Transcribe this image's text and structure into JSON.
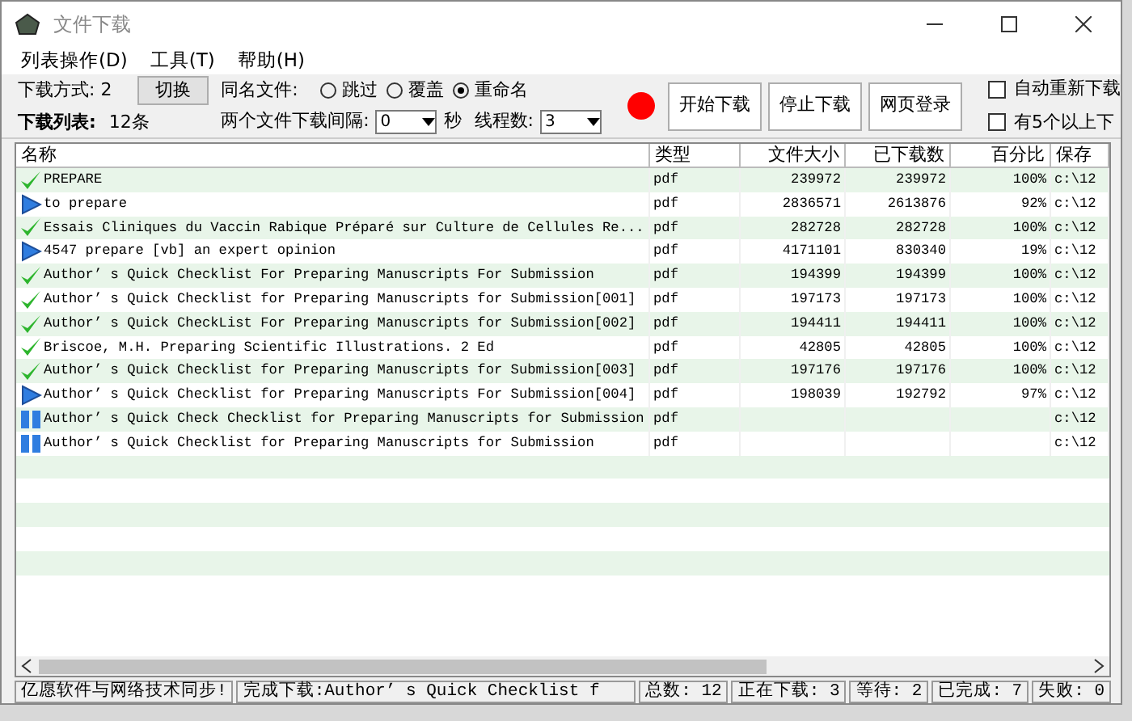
{
  "window": {
    "title": "文件下载"
  },
  "menu": [
    "列表操作(D)",
    "工具(T)",
    "帮助(H)"
  ],
  "toolbar": {
    "mode_label": "下载方式: 2",
    "switch_button": "切换",
    "list_label": "下载列表:",
    "list_count": "12条",
    "same_name_label": "同名文件:",
    "same_name_options": [
      {
        "label": "跳过",
        "selected": false
      },
      {
        "label": "覆盖",
        "selected": false
      },
      {
        "label": "重命名",
        "selected": true
      }
    ],
    "interval_label": "两个文件下载间隔:",
    "interval_value": "0",
    "seconds_label": "秒",
    "threads_label": "线程数:",
    "threads_value": "3",
    "buttons": [
      "开始下载",
      "停止下载",
      "网页登录"
    ],
    "checkboxes": [
      {
        "label": "自动重新下载",
        "checked": false
      },
      {
        "label": "有5个以上下",
        "checked": false
      }
    ]
  },
  "table": {
    "columns": [
      "名称",
      "类型",
      "文件大小",
      "已下载数",
      "百分比",
      "保存"
    ],
    "rows": [
      {
        "kind": "done",
        "cells": [
          "PREPARE",
          "pdf",
          "239972",
          "239972",
          "100%",
          "c:\\12"
        ]
      },
      {
        "kind": "downloading",
        "cells": [
          "to prepare",
          "pdf",
          "2836571",
          "2613876",
          "92%",
          "c:\\12"
        ]
      },
      {
        "kind": "done",
        "cells": [
          "Essais Cliniques du Vaccin Rabique Préparé sur Culture de Cellules Re...",
          "pdf",
          "282728",
          "282728",
          "100%",
          "c:\\12"
        ]
      },
      {
        "kind": "downloading",
        "cells": [
          "4547 prepare [vb] an expert opinion",
          "pdf",
          "4171101",
          "830340",
          "19%",
          "c:\\12"
        ]
      },
      {
        "kind": "done",
        "cells": [
          "Author’ s Quick Checklist For Preparing Manuscripts For Submission",
          "pdf",
          "194399",
          "194399",
          "100%",
          "c:\\12"
        ]
      },
      {
        "kind": "done",
        "cells": [
          "Author’ s Quick Checklist for Preparing Manuscripts for Submission[001]",
          "pdf",
          "197173",
          "197173",
          "100%",
          "c:\\12"
        ]
      },
      {
        "kind": "done",
        "cells": [
          "Author’ s Quick CheckList For Preparing Manuscripts for Submission[002]",
          "pdf",
          "194411",
          "194411",
          "100%",
          "c:\\12"
        ]
      },
      {
        "kind": "done",
        "cells": [
          "Briscoe, M.H. Preparing Scientific Illustrations. 2 Ed",
          "pdf",
          "42805",
          "42805",
          "100%",
          "c:\\12"
        ]
      },
      {
        "kind": "done",
        "cells": [
          "Author’ s Quick Checklist for Preparing Manuscripts for Submission[003]",
          "pdf",
          "197176",
          "197176",
          "100%",
          "c:\\12"
        ]
      },
      {
        "kind": "downloading",
        "cells": [
          "Author’ s Quick Checklist for Preparing Manuscripts For Submission[004]",
          "pdf",
          "198039",
          "192792",
          "97%",
          "c:\\12"
        ]
      },
      {
        "kind": "waiting",
        "cells": [
          "Author’ s Quick Check Checklist for Preparing Manuscripts for Submission",
          "pdf",
          "",
          "",
          "",
          "c:\\12"
        ]
      },
      {
        "kind": "waiting",
        "cells": [
          "Author’ s Quick Checklist for Preparing Manuscripts for Submission",
          "pdf",
          "",
          "",
          "",
          "c:\\12"
        ]
      }
    ]
  },
  "status_bar": [
    "亿愿软件与网络技术同步!",
    "完成下载:Author’ s Quick Checklist f",
    "总数: 12",
    "正在下载: 3",
    "等待: 2",
    "已完成: 7",
    "失败: 0"
  ]
}
